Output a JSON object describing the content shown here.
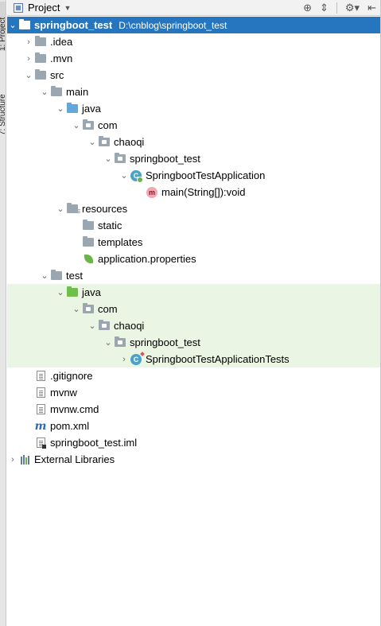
{
  "side_tabs": [
    "1: Project",
    "7: Structure"
  ],
  "header": {
    "title": "Project",
    "dropdown_icon": "chevron-down-icon",
    "tools": [
      "locate-icon",
      "collapse-all-icon",
      "gear-icon",
      "hide-icon"
    ]
  },
  "tree": [
    {
      "label": "springboot_test",
      "path": "D:\\cnblog\\springboot_test"
    },
    {
      "label": ".idea"
    },
    {
      "label": ".mvn"
    },
    {
      "label": "src"
    },
    {
      "label": "main"
    },
    {
      "label": "java"
    },
    {
      "label": "com"
    },
    {
      "label": "chaoqi"
    },
    {
      "label": "springboot_test"
    },
    {
      "label": "SpringbootTestApplication"
    },
    {
      "label": "main(String[]):void"
    },
    {
      "label": "resources"
    },
    {
      "label": "static"
    },
    {
      "label": "templates"
    },
    {
      "label": "application.properties"
    },
    {
      "label": "test"
    },
    {
      "label": "java"
    },
    {
      "label": "com"
    },
    {
      "label": "chaoqi"
    },
    {
      "label": "springboot_test"
    },
    {
      "label": "SpringbootTestApplicationTests"
    },
    {
      "label": ".gitignore"
    },
    {
      "label": "mvnw"
    },
    {
      "label": "mvnw.cmd"
    },
    {
      "label": "pom.xml"
    },
    {
      "label": "springboot_test.iml"
    },
    {
      "label": "External Libraries"
    }
  ],
  "icon_text": {
    "class": "C",
    "method": "m",
    "maven": "m"
  },
  "colors": {
    "selection": "#2675bf",
    "test_highlight": "#eaf5e3",
    "source_folder": "#62a8dd",
    "test_folder": "#6fbf4a"
  }
}
